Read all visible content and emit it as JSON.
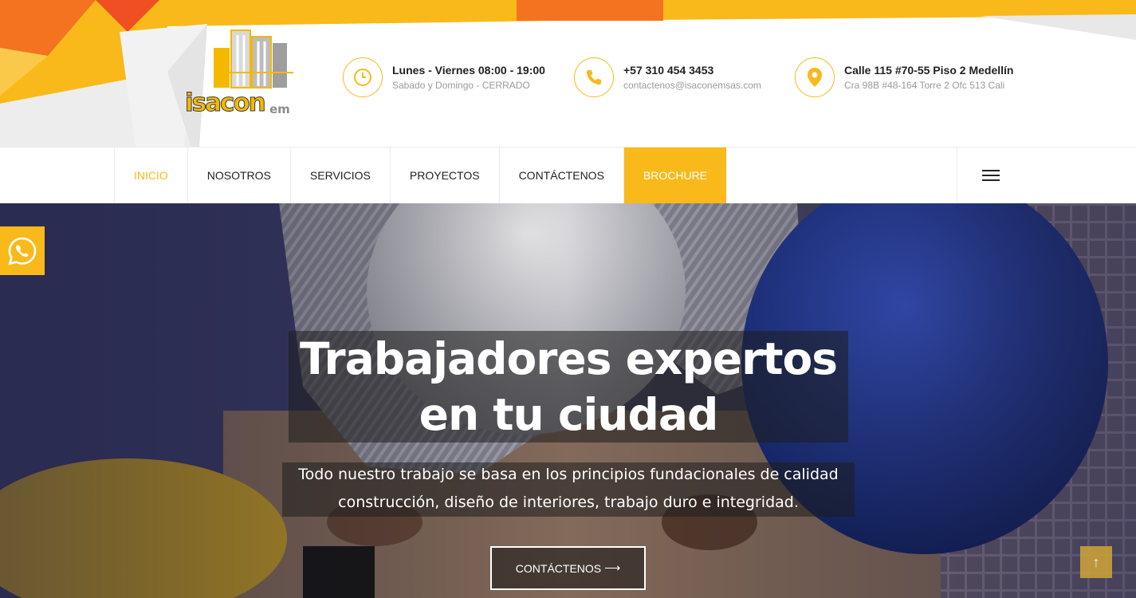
{
  "logo": {
    "word": "isacon",
    "suffix": "em"
  },
  "contact_info": [
    {
      "icon": "clock-icon",
      "title": "Lunes - Viernes 08:00 - 19:00",
      "subtitle": "Sabado y Domingo - CERRADO"
    },
    {
      "icon": "phone-icon",
      "title": "+57 310 454 3453",
      "subtitle": "contactenos@isaconemsas.com"
    },
    {
      "icon": "map-pin-icon",
      "title": "Calle 115 #70-55 Piso 2 Medellín",
      "subtitle": "Cra 98B #48-164 Torre 2 Ofc 513 Cali"
    }
  ],
  "nav": {
    "items": [
      "INICIO",
      "NOSOTROS",
      "SERVICIOS",
      "PROYECTOS",
      "CONTÁCTENOS",
      "BROCHURE"
    ],
    "active": "INICIO",
    "highlighted": "BROCHURE"
  },
  "hero": {
    "title_line1": "Trabajadores expertos",
    "title_line2": "en tu ciudad",
    "subtitle_line1": "Todo nuestro trabajo se basa en los principios fundacionales de calidad",
    "subtitle_line2": "construcción, diseño de interiores, trabajo duro e integridad.",
    "button_label": "CONTÁCTENOS",
    "button_arrow": "⟶"
  },
  "floating": {
    "whatsapp_icon": "whatsapp-icon",
    "back_to_top_icon": "arrow-up-icon",
    "back_to_top_glyph": "↑"
  },
  "colors": {
    "accent": "#f9b91a",
    "orange": "#f37321",
    "text_dark": "#222222",
    "text_muted": "#9a9a9a"
  }
}
